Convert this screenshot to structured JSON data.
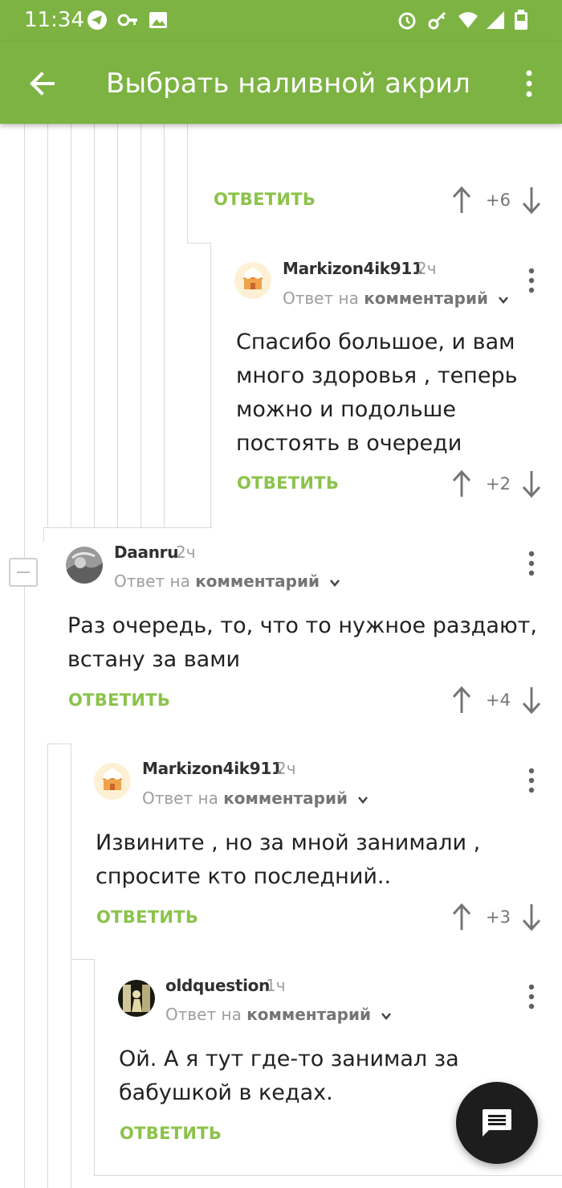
{
  "status_bar": {
    "time": "11:34",
    "left_icons": [
      "telegram-icon",
      "key-icon",
      "image-icon"
    ],
    "right_icons": [
      "alarm-icon",
      "vpn-key-icon",
      "wifi-icon",
      "signal-icon",
      "battery-icon"
    ]
  },
  "app_bar": {
    "title": "Выбрать наливной акрил",
    "back_icon": "arrow-back-icon",
    "menu_icon": "more-vert-icon",
    "color": "#7cb342"
  },
  "colors": {
    "accent": "#8bc34a",
    "text": "#212121",
    "muted": "#9e9e9e"
  },
  "top_action_row": {
    "reply_label": "ОТВЕТИТЬ",
    "score": "+6"
  },
  "comments": [
    {
      "author": "Markizon4ik911",
      "time": "2ч",
      "reply_prefix": "Ответ на",
      "reply_target": "комментарий",
      "lines": [
        "Спасибо большое, и вам",
        "много здоровья , теперь",
        "можно и подольше",
        "постоять в очереди"
      ],
      "reply_label": "ОТВЕТИТЬ",
      "score": "+2"
    },
    {
      "author": "Daanru",
      "time": "2ч",
      "reply_prefix": "Ответ на",
      "reply_target": "комментарий",
      "lines": [
        "Раз очередь, то, что то нужное раздают,",
        "встану за вами"
      ],
      "reply_label": "ОТВЕТИТЬ",
      "score": "+4"
    },
    {
      "author": "Markizon4ik911",
      "time": "2ч",
      "reply_prefix": "Ответ на",
      "reply_target": "комментарий",
      "lines": [
        "Извините , но за мной занимали ,",
        "спросите кто последний.."
      ],
      "reply_label": "ОТВЕТИТЬ",
      "score": "+3"
    },
    {
      "author": "oldquestion",
      "time": "1ч",
      "reply_prefix": "Ответ на",
      "reply_target": "комментарий",
      "lines": [
        "Ой. А я тут где-то занимал за",
        "бабушкой в кедах."
      ],
      "reply_label": "ОТВЕТИТЬ"
    }
  ],
  "fab": {
    "icon": "comment-icon"
  }
}
